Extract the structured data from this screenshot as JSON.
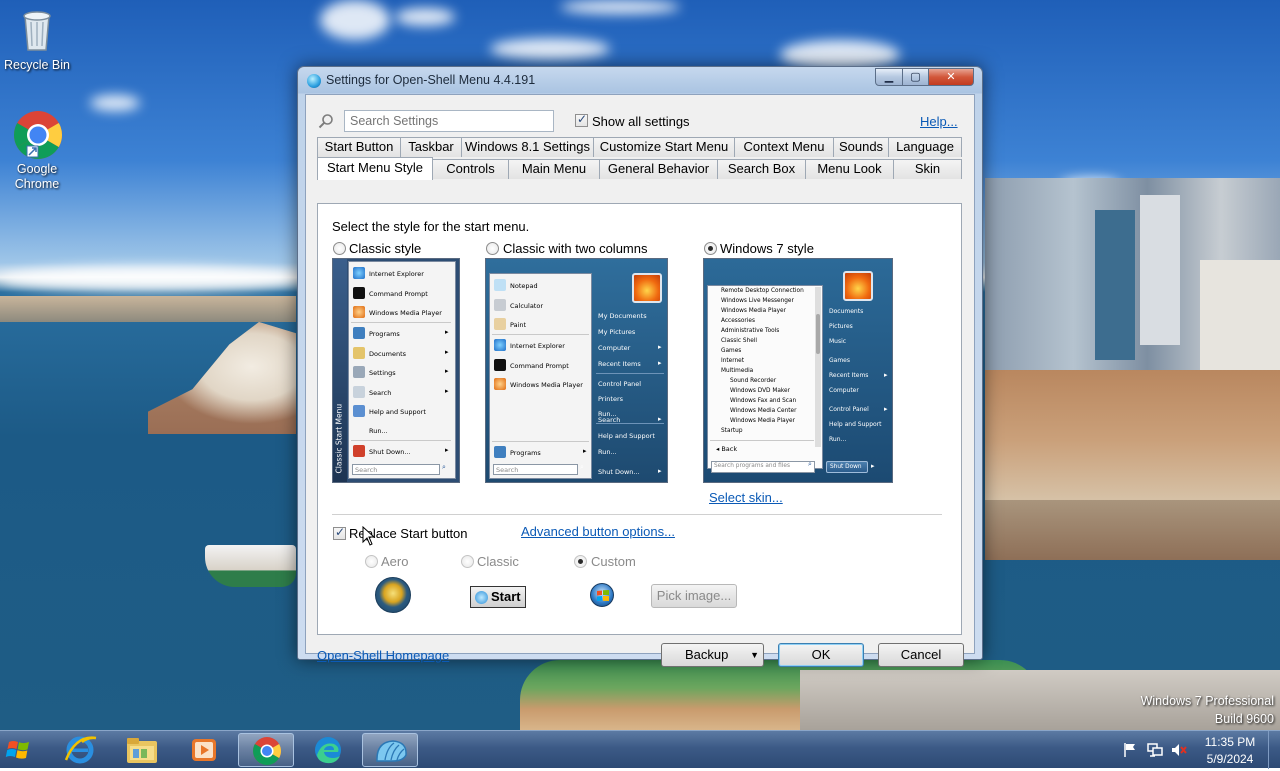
{
  "desktop": {
    "icons": [
      {
        "label": "Recycle Bin",
        "icon": "recycle-bin-icon"
      },
      {
        "label": "Google Chrome",
        "icon": "chrome-icon"
      }
    ],
    "watermark_line1": "Windows 7 Professional",
    "watermark_line2": "Build 9600"
  },
  "window": {
    "title": "Settings for Open-Shell Menu 4.4.191",
    "controls": {
      "minimize": "▁",
      "maximize": "▢",
      "close": "✕"
    },
    "search_placeholder": "Search Settings",
    "show_all_settings_label": "Show all settings",
    "show_all_settings_checked": true,
    "help_link": "Help...",
    "tabs_row1": [
      "Start Button",
      "Taskbar",
      "Windows 8.1 Settings",
      "Customize Start Menu",
      "Context Menu",
      "Sounds",
      "Language"
    ],
    "tabs_row2": [
      "Start Menu Style",
      "Controls",
      "Main Menu",
      "General Behavior",
      "Search Box",
      "Menu Look",
      "Skin"
    ],
    "active_tab": "Start Menu Style",
    "panel": {
      "instruction": "Select the style for the start menu.",
      "styles": [
        {
          "label": "Classic style",
          "selected": false
        },
        {
          "label": "Classic with two columns",
          "selected": false
        },
        {
          "label": "Windows 7 style",
          "selected": true
        }
      ],
      "select_skin_link": "Select skin...",
      "replace_start_label": "Replace Start button",
      "replace_start_checked": true,
      "advanced_link": "Advanced button options...",
      "button_styles": [
        {
          "label": "Aero",
          "selected": false
        },
        {
          "label": "Classic",
          "selected": false
        },
        {
          "label": "Custom",
          "selected": true
        }
      ],
      "classic_start_caption": "Start",
      "pick_image_label": "Pick image..."
    },
    "preview_classic": {
      "sidebar_text": "Classic Start Menu",
      "items": [
        "Internet Explorer",
        "Command Prompt",
        "Windows Media Player",
        "Programs",
        "Documents",
        "Settings",
        "Search",
        "Help and Support",
        "Run...",
        "Shut Down..."
      ],
      "search_placeholder": "Search"
    },
    "preview_two_columns": {
      "left_items": [
        "Notepad",
        "Calculator",
        "Paint",
        "Internet Explorer",
        "Command Prompt",
        "Windows Media Player"
      ],
      "programs": "Programs",
      "right_items": [
        "My Documents",
        "My Pictures",
        "Computer",
        "Recent Items",
        "Control Panel",
        "Printers",
        "Run...",
        "Search",
        "Help and Support",
        "Run...",
        "Shut Down..."
      ],
      "search_placeholder": "Search"
    },
    "preview_win7": {
      "left_items": [
        "Remote Desktop Connection",
        "Windows Live Messenger",
        "Windows Media Player",
        "Accessories",
        "Administrative Tools",
        "Classic Shell",
        "Games",
        "Internet",
        "Multimedia",
        "Sound Recorder",
        "Windows DVD Maker",
        "Windows Fax and Scan",
        "Windows Media Center",
        "Windows Media Player",
        "Startup"
      ],
      "back": "Back",
      "search_placeholder": "Search programs and files",
      "right_items": [
        "Documents",
        "Pictures",
        "Music",
        "Games",
        "Recent Items",
        "Computer",
        "Control Panel",
        "Help and Support",
        "Run..."
      ],
      "shutdown": "Shut Down"
    },
    "footer": {
      "homepage_link": "Open-Shell Homepage",
      "backup_label": "Backup",
      "ok_label": "OK",
      "cancel_label": "Cancel"
    }
  },
  "taskbar": {
    "time": "11:35 PM",
    "date": "5/9/2024",
    "items": [
      "start-orb",
      "internet-explorer",
      "file-explorer",
      "media-player",
      "chrome",
      "edge",
      "open-shell"
    ]
  }
}
